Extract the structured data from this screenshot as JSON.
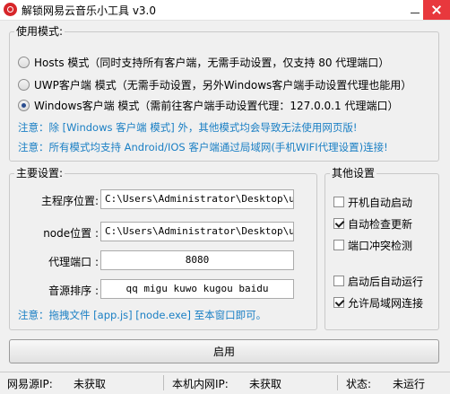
{
  "window": {
    "title": "解锁网易云音乐小工具 v3.0"
  },
  "mode_group": {
    "legend": "使用模式:",
    "options": [
      {
        "label": "Hosts 模式（同时支持所有客户端，无需手动设置，仅支持 80 代理端口）",
        "selected": false
      },
      {
        "label": "UWP客户端 模式（无需手动设置，另外Windows客户端手动设置代理也能用）",
        "selected": false
      },
      {
        "label": "Windows客户端 模式（需前往客户端手动设置代理：127.0.0.1 代理端口）",
        "selected": true
      }
    ],
    "note1": "注意：除 [Windows 客户端 模式] 外，其他模式均会导致无法使用网页版!",
    "note2": "注意：所有模式均支持 Android/IOS 客户端通过局域网(手机WIFI代理设置)连接!"
  },
  "main_settings": {
    "legend": "主要设置:",
    "program_path_label": "主程序位置:",
    "program_path_value": "C:\\Users\\Administrator\\Desktop\\ucbu",
    "node_path_label": "node位置 :",
    "node_path_value": "C:\\Users\\Administrator\\Desktop\\ucbu",
    "proxy_port_label": "代理端口 :",
    "proxy_port_value": "8080",
    "source_order_label": "音源排序 :",
    "source_order_value": "qq migu kuwo kugou baidu",
    "note": "注意：拖拽文件 [app.js] [node.exe] 至本窗口即可。"
  },
  "other_settings": {
    "legend": "其他设置",
    "options": [
      {
        "label": "开机自动启动",
        "checked": false
      },
      {
        "label": "自动检查更新",
        "checked": true
      },
      {
        "label": "端口冲突检测",
        "checked": false
      },
      {
        "label": "启动后自动运行",
        "checked": false
      },
      {
        "label": "允许局域网连接",
        "checked": true
      }
    ]
  },
  "start_button": {
    "label": "启用"
  },
  "status": {
    "netease_ip_label": "网易源IP:",
    "netease_ip_value": "未获取",
    "local_ip_label": "本机内网IP:",
    "local_ip_value": "未获取",
    "state_label": "状态:",
    "state_value": "未运行"
  },
  "colors": {
    "note": "#1a7fc4",
    "close_button": "#e8383d",
    "app_icon": "#d7262a"
  }
}
